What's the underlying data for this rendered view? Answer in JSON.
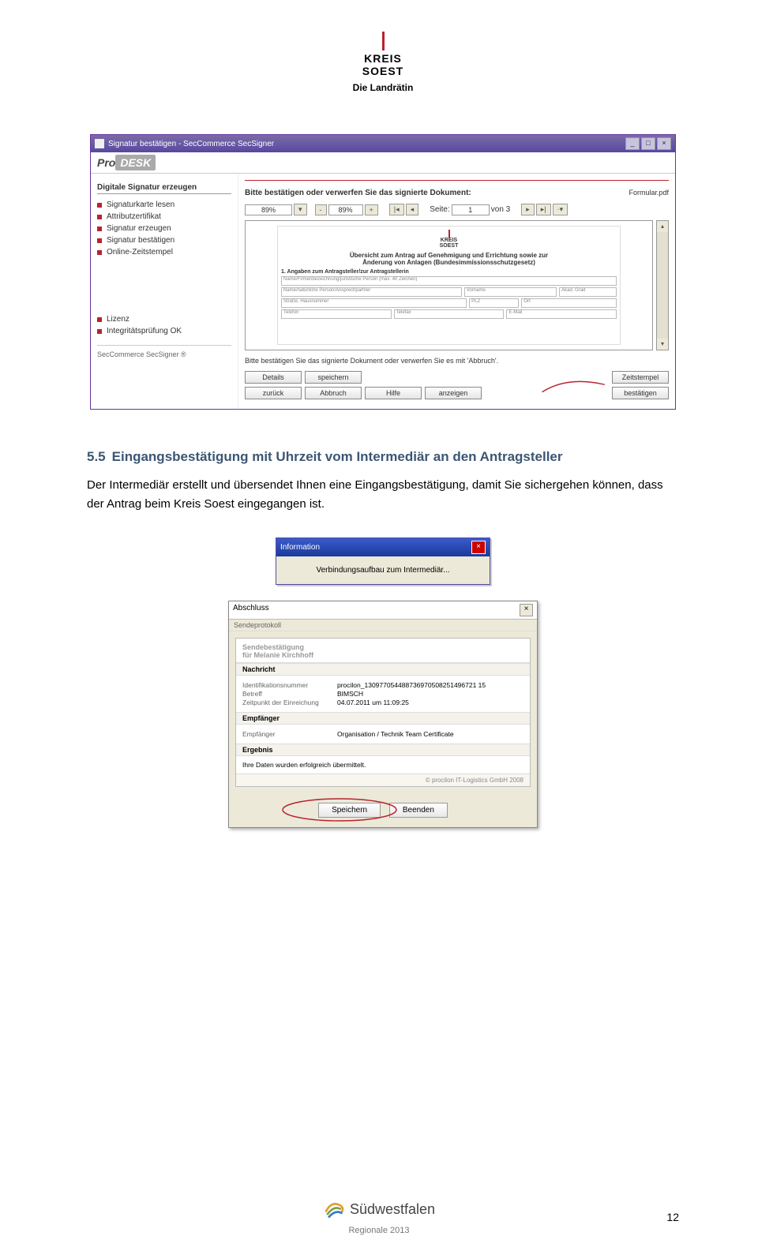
{
  "header": {
    "brand_line1": "KREIS",
    "brand_line2": "SOEST",
    "subtitle": "Die Landrätin"
  },
  "screenshot1": {
    "window_title": "Signatur bestätigen  - SecCommerce SecSigner",
    "prodesk_pro": "Pro",
    "prodesk_desk": "DESK",
    "left_heading": "Digitale Signatur erzeugen",
    "left_items": [
      "Signaturkarte lesen",
      "Attributzertifikat",
      "Signatur erzeugen",
      "Signatur bestätigen",
      "Online-Zeitstempel"
    ],
    "left_bottom": [
      "Lizenz",
      "Integritätsprüfung OK"
    ],
    "left_footer": "SecCommerce SecSigner ®",
    "hint": "Bitte bestätigen oder verwerfen Sie das signierte Dokument:",
    "file": "Formular.pdf",
    "zoom1": "89%",
    "zoom2": "89%",
    "page_label": "Seite:",
    "page_val": "1",
    "page_total": "von 3",
    "doc_title1": "Übersicht zum Antrag auf Genehmigung und Errichtung sowie zur",
    "doc_title2": "Änderung von Anlagen (Bundesimmissionsschutzgesetz)",
    "doc_sec1": "1.   Angaben zum Antragsteller/zur Antragstellerin",
    "field_labels": [
      "Name/Firmenbezeichnung/juristische Person (max. 40 Zeichen)",
      "Name/natürliche Person/Ansprechpartner",
      "Vorname",
      "Akad. Grad",
      "Straße, Hausnummer",
      "PLZ",
      "Ort",
      "Telefon",
      "Telefax",
      "E-Mail"
    ],
    "confirm_text": "Bitte bestätigen Sie das signierte Dokument oder verwerfen Sie es mit 'Abbruch'.",
    "btn_row1": [
      "Details",
      "speichern"
    ],
    "btn_row1_right": "Zeitstempel",
    "btn_row2": [
      "zurück",
      "Abbruch",
      "Hilfe",
      "anzeigen"
    ],
    "btn_row2_right": "bestätigen"
  },
  "section": {
    "number": "5.5",
    "title": "Eingangsbestätigung mit Uhrzeit vom Intermediär an den Antragsteller",
    "body": "Der Intermediär erstellt und übersendet Ihnen eine Eingangsbestätigung, damit Sie sichergehen können, dass der Antrag beim Kreis Soest eingegangen ist."
  },
  "info_dialog": {
    "title": "Information",
    "body": "Verbindungsaufbau zum Intermediär..."
  },
  "abschluss": {
    "title": "Abschluss",
    "sub": "Sendeprotokoll",
    "head_line1": "Sendebestätigung",
    "head_for": "für",
    "head_name": "Melanie Kirchhoff",
    "sec_nachricht": "Nachricht",
    "rows_nachricht": [
      {
        "k": "Identifikationsnummer",
        "v": "procilon_130977054488736970508251496721 15"
      },
      {
        "k": "Betreff",
        "v": "BIMSCH"
      },
      {
        "k": "Zeitpunkt der Einreichung",
        "v": "04.07.2011 um 11:09:25"
      }
    ],
    "sec_empf": "Empfänger",
    "rows_empf": [
      {
        "k": "Empfänger",
        "v": "Organisation / Technik Team Certificate"
      }
    ],
    "sec_erg": "Ergebnis",
    "erg_text": "Ihre Daten wurden erfolgreich übermittelt.",
    "credit": "© procilon IT-Logistics GmbH 2008",
    "btn_speichern": "Speichern",
    "btn_beenden": "Beenden"
  },
  "footer": {
    "brand": "Südwestfalen",
    "sub": "Regionale 2013",
    "page": "12"
  }
}
